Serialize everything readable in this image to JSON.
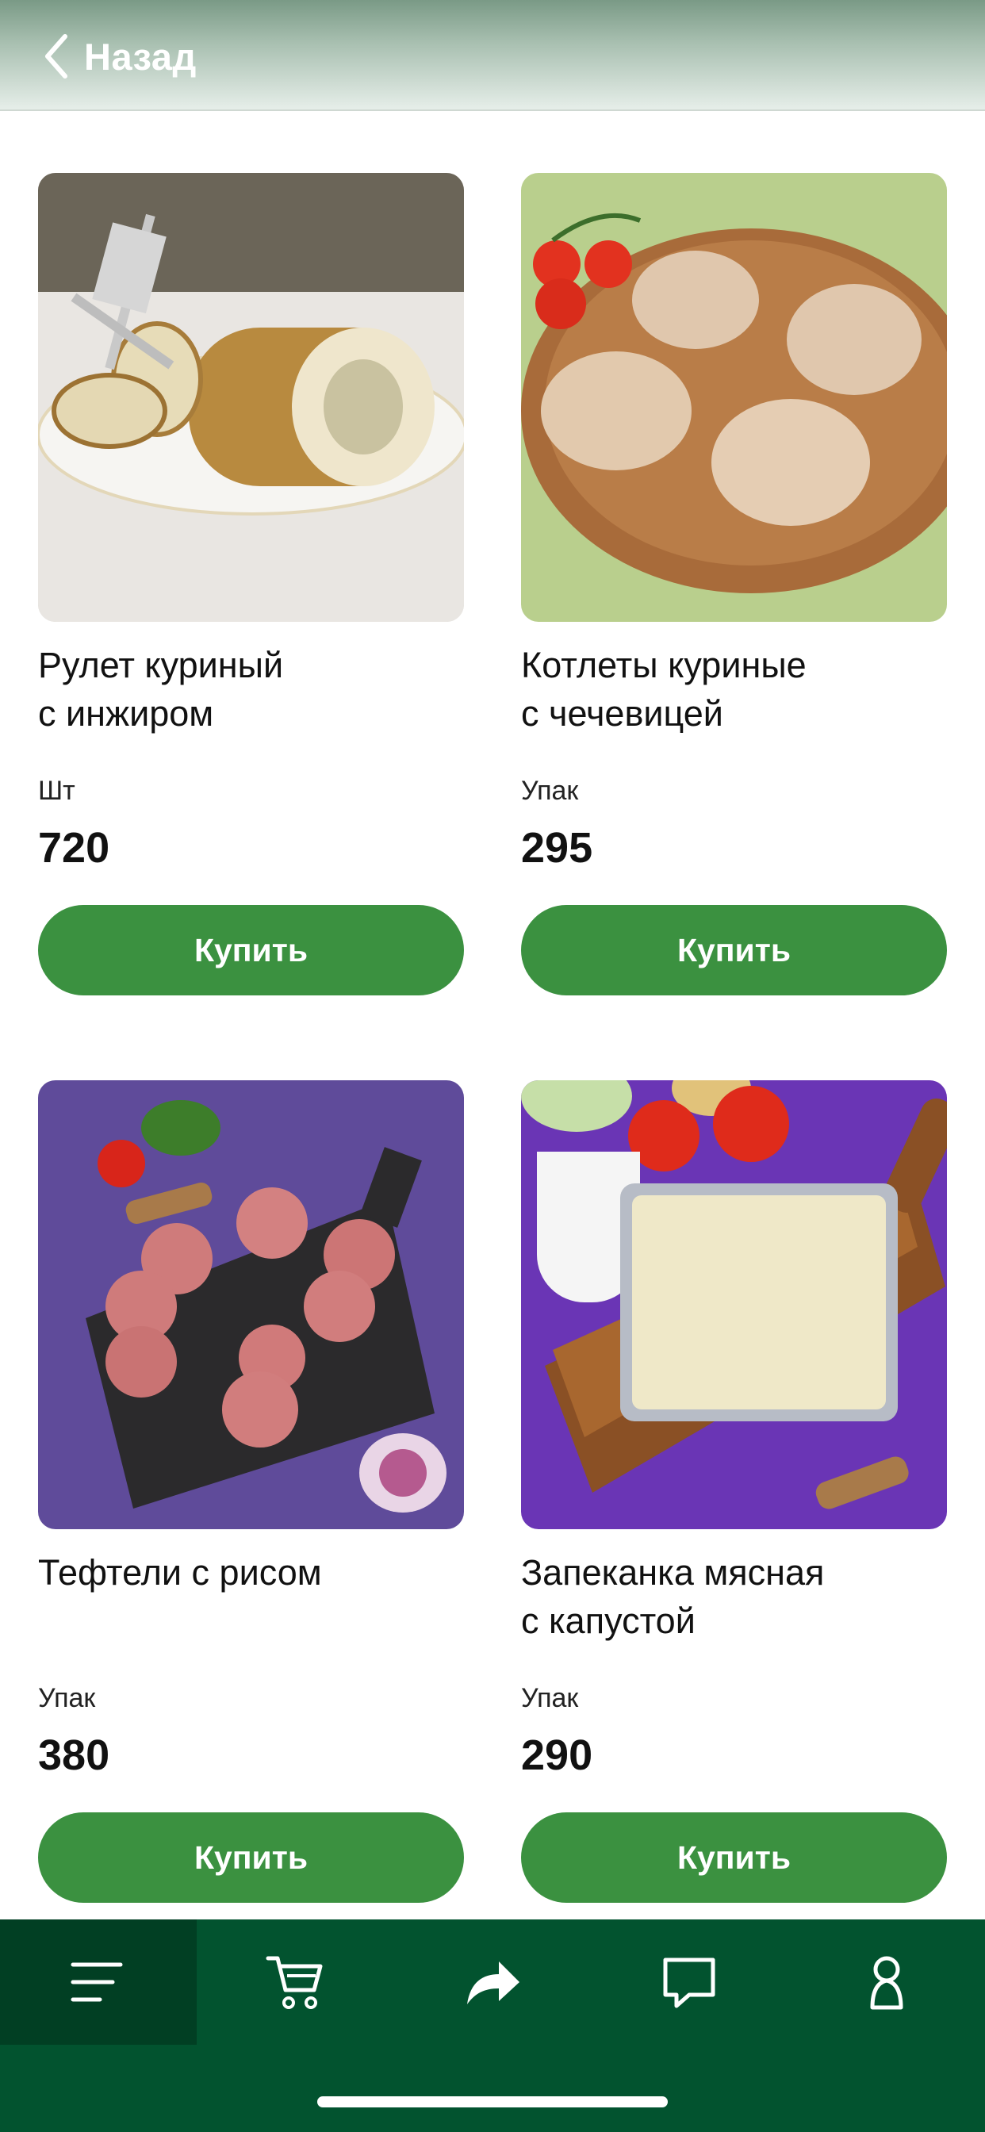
{
  "header": {
    "back_label": "Назад"
  },
  "products": [
    {
      "title": "Рулет куриный\nс инжиром",
      "unit": "Шт",
      "price": "720",
      "buy_label": "Купить"
    },
    {
      "title": "Котлеты куриные\nс чечевицей",
      "unit": "Упак",
      "price": "295",
      "buy_label": "Купить"
    },
    {
      "title": "Тефтели с рисом",
      "unit": "Упак",
      "price": "380",
      "buy_label": "Купить"
    },
    {
      "title": "Запеканка мясная\nс капустой",
      "unit": "Упак",
      "price": "290",
      "buy_label": "Купить"
    }
  ],
  "tabbar": {
    "items": [
      "menu-icon",
      "cart-icon",
      "share-icon",
      "chat-icon",
      "profile-icon"
    ],
    "active": "menu-icon"
  },
  "colors": {
    "buy_button": "#3b9140",
    "tabbar": "#02532f",
    "tabbar_active": "#013f23"
  }
}
